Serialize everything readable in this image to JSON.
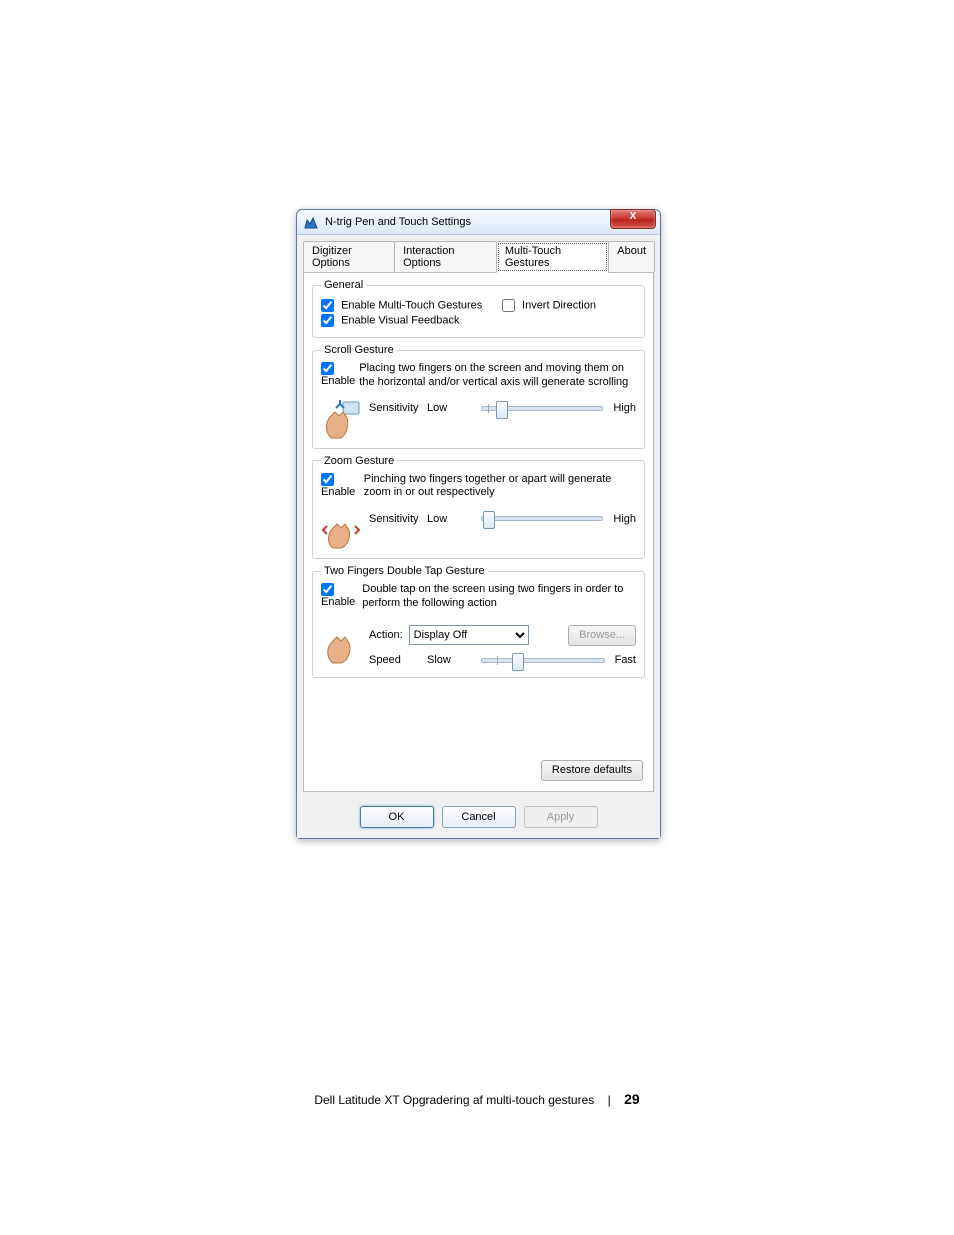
{
  "window": {
    "title": "N-trig Pen and Touch Settings",
    "close_label": "X"
  },
  "tabs": {
    "digitizer": "Digitizer Options",
    "interaction": "Interaction Options",
    "multitouch": "Multi-Touch Gestures",
    "about": "About"
  },
  "general": {
    "legend": "General",
    "enable_mt": "Enable Multi-Touch Gestures",
    "enable_vf": "Enable Visual Feedback",
    "invert": "Invert Direction"
  },
  "scroll": {
    "legend": "Scroll Gesture",
    "enable": "Enable",
    "desc": "Placing two fingers on the screen and moving them on the horizontal and/or vertical axis will generate scrolling",
    "sens": "Sensitivity",
    "low": "Low",
    "high": "High"
  },
  "zoom": {
    "legend": "Zoom Gesture",
    "enable": "Enable",
    "desc": "Pinching two fingers together or apart will generate zoom in or out respectively",
    "sens": "Sensitivity",
    "low": "Low",
    "high": "High"
  },
  "dtap": {
    "legend": "Two Fingers Double Tap Gesture",
    "enable": "Enable",
    "desc": "Double tap on the screen using two fingers in order to perform the following action",
    "action_lbl": "Action:",
    "action_sel": "Display Off",
    "browse": "Browse...",
    "speed": "Speed",
    "slow": "Slow",
    "fast": "Fast"
  },
  "buttons": {
    "restore": "Restore defaults",
    "ok": "OK",
    "cancel": "Cancel",
    "apply": "Apply"
  },
  "footer": {
    "text": "Dell Latitude XT Opgradering af multi-touch gestures",
    "page": "29"
  }
}
